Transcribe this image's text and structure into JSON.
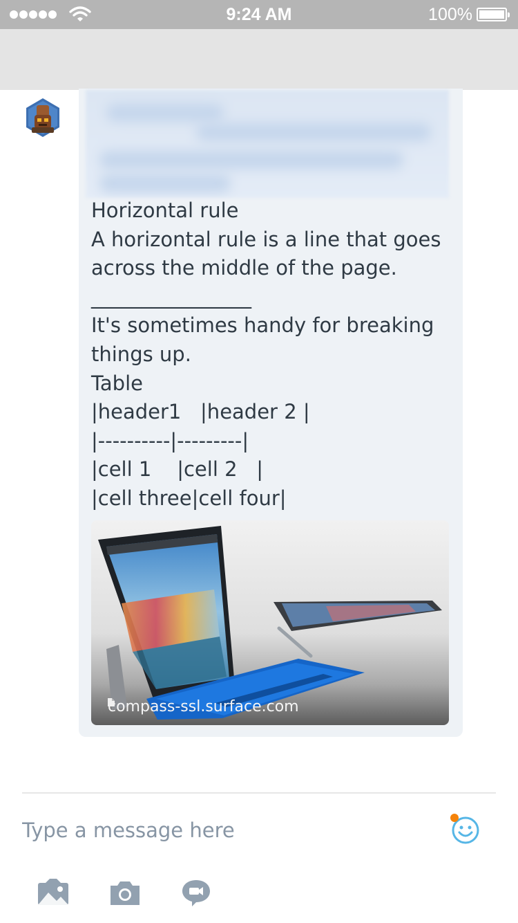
{
  "status_bar": {
    "time": "9:24 AM",
    "battery": "100%"
  },
  "message": {
    "lines": [
      "Horizontal rule",
      "A horizontal rule is a line that goes across the middle of the page.",
      "________________",
      "It's sometimes handy for breaking things up.",
      "Table",
      "|header1   |header 2 |",
      "|----------|---------|",
      "|cell 1    |cell 2   |",
      "|cell three|cell four|"
    ],
    "link_preview": {
      "domain": "compass-ssl.surface.com"
    }
  },
  "composer": {
    "placeholder": "Type a message here"
  },
  "colors": {
    "bubble_background": "#eef2f6",
    "accent_icon": "#56b6e6",
    "notification_dot": "#f5830a",
    "toolbar_icon": "#92a1b0"
  },
  "icons": {
    "emoji": "smiley-face-icon",
    "gallery": "image-gallery-icon",
    "camera": "camera-icon",
    "video_message": "video-message-icon"
  }
}
